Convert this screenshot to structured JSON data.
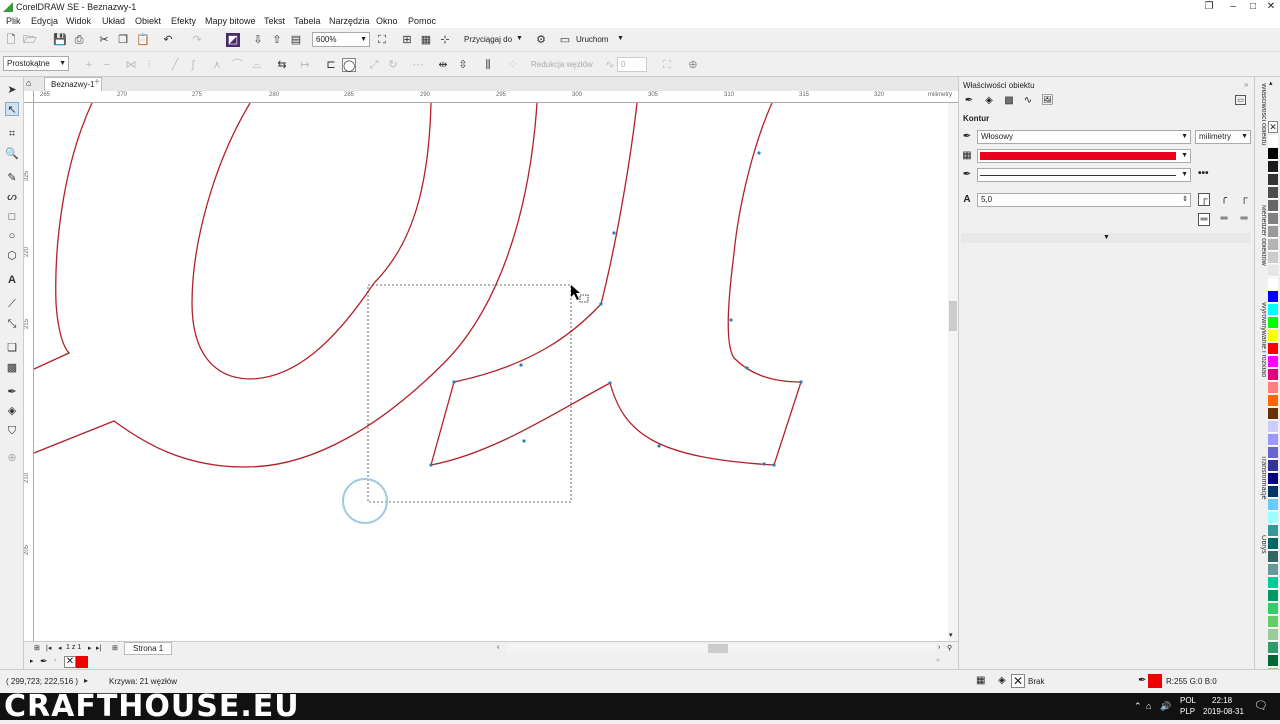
{
  "window": {
    "title": "CorelDRAW SE - Beznazwy-1",
    "controls": [
      "❐",
      "–",
      "□",
      "✕"
    ]
  },
  "menu": [
    "Plik",
    "Edycja",
    "Widok",
    "Układ",
    "Obiekt",
    "Efekty",
    "Mapy bitowe",
    "Tekst",
    "Tabela",
    "Narzędzia",
    "Okno",
    "Pomoc"
  ],
  "toolbar": {
    "zoom": "600%",
    "snap_label": "Przyciągaj do",
    "launch_label": "Uruchom"
  },
  "propertybar": {
    "node_mode": "Prostokątne",
    "reduce_nodes_label": "Redukcja węzłów",
    "smoothing_value": "0"
  },
  "document": {
    "tab_label": "Beznazwy-1",
    "ruler_unit": "milimetry",
    "ruler_ticks": [
      "265",
      "270",
      "275",
      "280",
      "285",
      "290",
      "295",
      "300",
      "305",
      "310",
      "315",
      "320"
    ],
    "vruler_ticks": [
      "225",
      "220",
      "215",
      "210",
      "205"
    ]
  },
  "pagebar": {
    "page_counter": "1 z 1",
    "page_tab": "Strona 1"
  },
  "status": {
    "coordinates": "( 299,723; 222,516 )",
    "object_info": "Krzywa: 21 węzłów",
    "fill_label": "Brak",
    "outline_color_label": "R:255 G:0 B:0"
  },
  "panel": {
    "title": "Właściwości obiektu",
    "section": "Kontur",
    "width_value": "Włosowy",
    "unit_value": "milimetry",
    "miter_value": "5,0",
    "outline_color": "#e8001c"
  },
  "dockers": [
    "Właściwości obiektu",
    "Menedżer obiektów",
    "Wyrównywanie i rozkład",
    "Transformacje",
    "Obrys"
  ],
  "palette": [
    "#ffffff",
    "#000000",
    "#1a1a1a",
    "#333333",
    "#4d4d4d",
    "#666666",
    "#808080",
    "#999999",
    "#b3b3b3",
    "#cccccc",
    "#e6e6e6",
    "#ffffff",
    "#0000ff",
    "#00ffff",
    "#00ff00",
    "#ffff00",
    "#ff0000",
    "#ff00ff",
    "#e4007c",
    "#ff7f7f",
    "#ff6600",
    "#663300",
    "#ccccff",
    "#9999ff",
    "#6666cc",
    "#333399",
    "#000080",
    "#003366",
    "#66ccff",
    "#99ffff",
    "#339999",
    "#006666",
    "#336666",
    "#669999",
    "#00cc99",
    "#009966",
    "#33cc66",
    "#66cc66",
    "#99cc99",
    "#339966",
    "#006633",
    "#99cc66"
  ],
  "taskbar": {
    "watermark": "CRAFTHOUSE.EU",
    "lang": "POL",
    "lang2": "PLP",
    "time": "22:18",
    "date": "2019-08-31"
  }
}
